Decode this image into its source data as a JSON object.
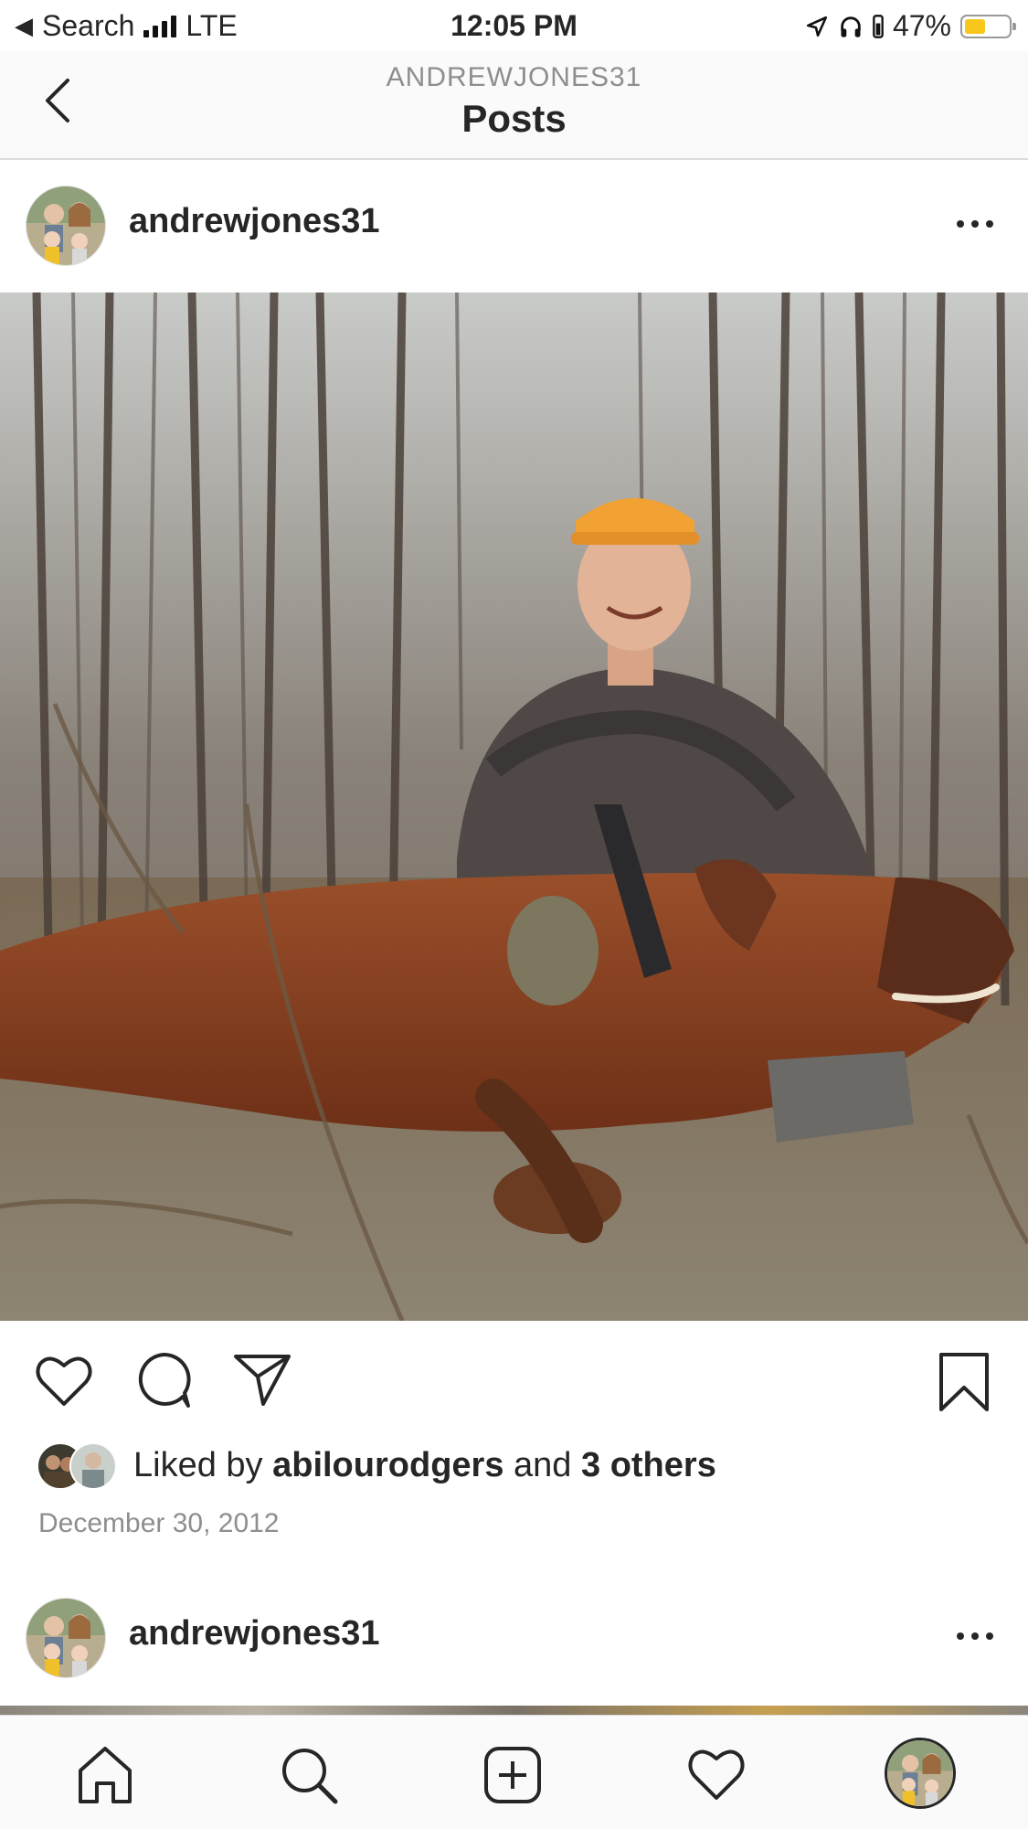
{
  "status_bar": {
    "back_app": "Search",
    "carrier": "LTE",
    "time": "12:05 PM",
    "battery": "47%",
    "battery_level": 0.47
  },
  "header": {
    "username": "ANDREWJONES31",
    "title": "Posts"
  },
  "posts": [
    {
      "username": "andrewjones31",
      "liked_by_prefix": "Liked by ",
      "liked_by_user": "abilourodgers",
      "liked_by_joiner": " and ",
      "liked_by_others": "3 others",
      "date": "December 30, 2012"
    },
    {
      "username": "andrewjones31"
    }
  ],
  "icons": {
    "back": "chevron-left-icon",
    "more": "more-dots-icon",
    "like": "heart-icon",
    "comment": "comment-icon",
    "share": "paper-plane-icon",
    "save": "bookmark-icon",
    "home": "home-icon",
    "search": "search-icon",
    "new_post": "plus-square-icon",
    "activity": "heart-icon",
    "profile": "avatar"
  },
  "colors": {
    "text": "#262626",
    "secondary": "#8e8e8e",
    "battery_fill": "#f7c71b"
  }
}
